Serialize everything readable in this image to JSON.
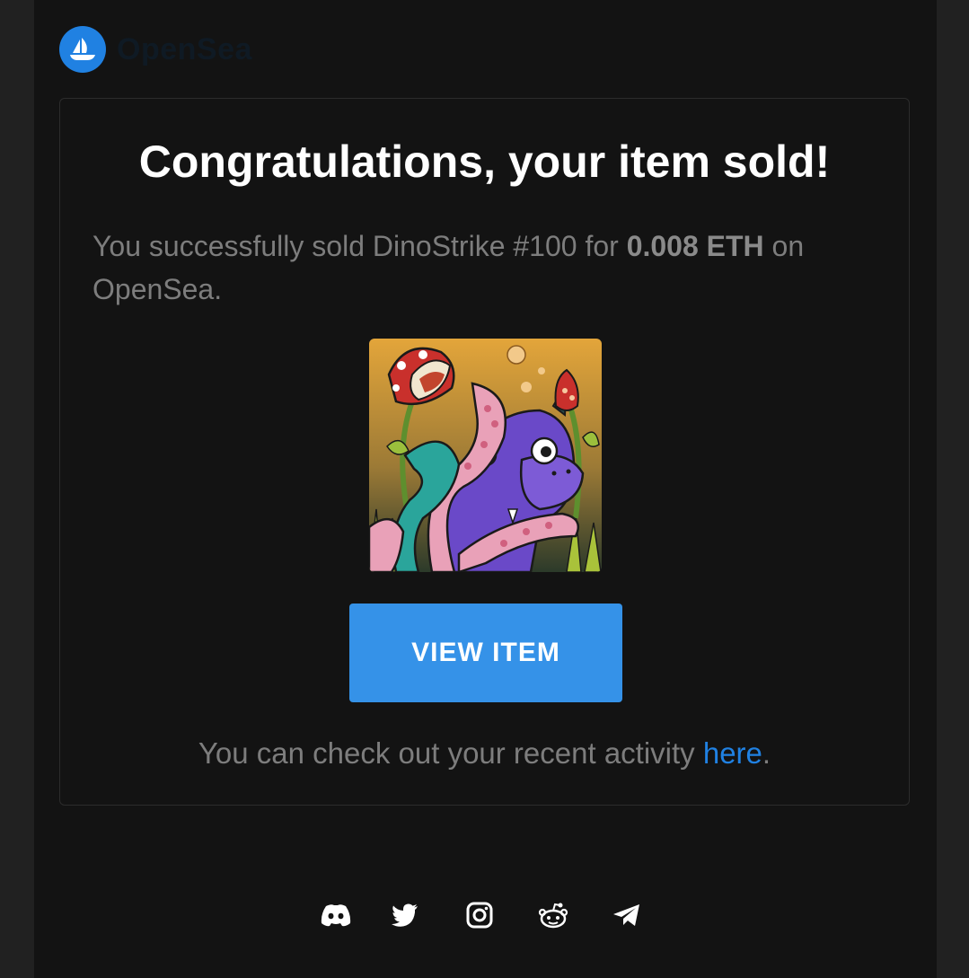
{
  "brand": {
    "name": "OpenSea",
    "accent_color": "#2081e2",
    "logo_icon": "opensea-ship-icon"
  },
  "email": {
    "headline": "Congratulations, your item sold!",
    "message_prefix": "You successfully sold DinoStrike #100 for ",
    "sale_price": "0.008 ETH",
    "message_suffix": " on OpenSea.",
    "item_image_alt": "DinoStrike #100",
    "view_button_label": "VIEW ITEM",
    "activity_prefix": "You can check out your recent activity ",
    "activity_link": "here",
    "activity_suffix": "."
  },
  "footer": {
    "social_icons": [
      "discord-icon",
      "twitter-icon",
      "instagram-icon",
      "reddit-icon",
      "telegram-icon"
    ]
  },
  "colors": {
    "button": "#3592e8",
    "link": "#2081e2",
    "page_background": "#212121",
    "email_background": "#131313"
  }
}
